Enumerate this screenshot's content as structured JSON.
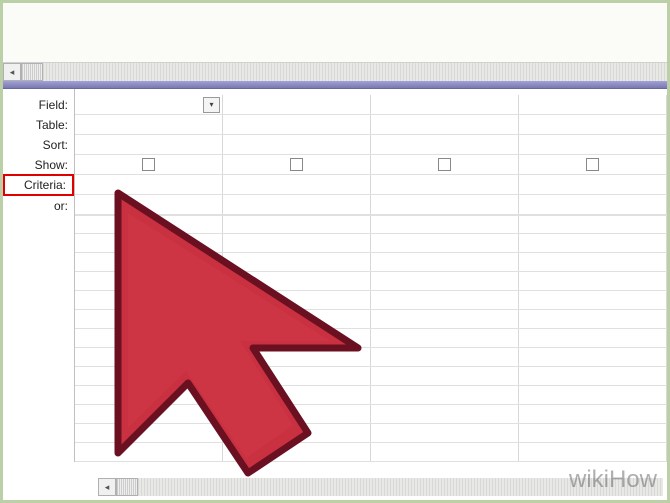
{
  "row_labels": {
    "field": "Field:",
    "table": "Table:",
    "sort": "Sort:",
    "show": "Show:",
    "criteria": "Criteria:",
    "or": "or:"
  },
  "watermark": "wikiHow"
}
